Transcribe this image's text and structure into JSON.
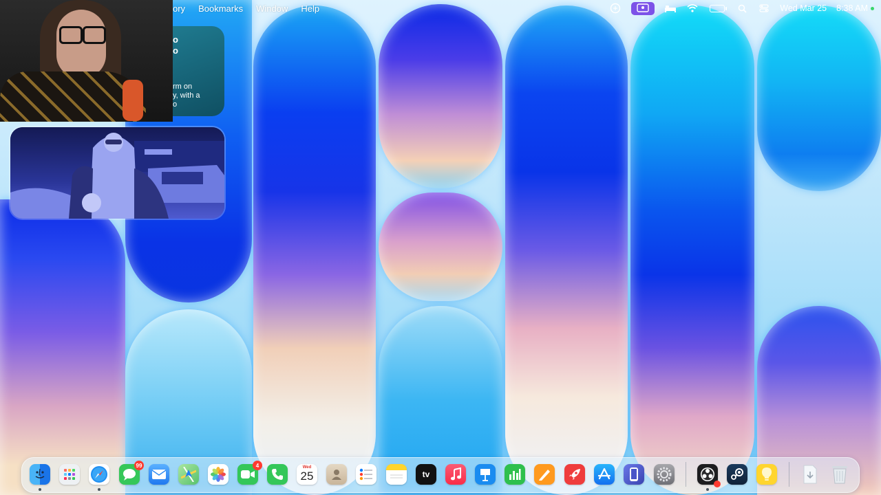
{
  "menubar": {
    "menus": [
      "ory",
      "Bookmarks",
      "Window",
      "Help"
    ],
    "clock": {
      "date": "Wed Mar 25",
      "time": "8:38 AM"
    },
    "icons": [
      "screen-share-icon",
      "user-switch-icon",
      "bed-sleep-icon",
      "wifi-icon",
      "battery-icon",
      "spotlight-search-icon",
      "control-center-icon"
    ]
  },
  "widgets": {
    "note": {
      "title_lines": [
        "o",
        "o"
      ],
      "body_lines": [
        "rm on",
        "y, with a",
        "o"
      ]
    }
  },
  "dock": {
    "apps": [
      {
        "name": "Finder",
        "icon": "finder-icon",
        "color": "#1e8ff0",
        "running": true
      },
      {
        "name": "Launchpad",
        "icon": "launchpad-icon",
        "color": "#e9ecef"
      },
      {
        "name": "Safari",
        "icon": "safari-icon",
        "color": "#1a7ef2",
        "running": true
      },
      {
        "name": "Messages",
        "icon": "messages-icon",
        "color": "#35c759",
        "badge": "99"
      },
      {
        "name": "Mail",
        "icon": "mail-icon",
        "color": "#2f8cf2"
      },
      {
        "name": "Maps",
        "icon": "maps-icon",
        "color": "#58c16c"
      },
      {
        "name": "Photos",
        "icon": "photos-icon",
        "color": "#ffffff"
      },
      {
        "name": "FaceTime",
        "icon": "facetime-icon",
        "color": "#34c759",
        "badge": "4"
      },
      {
        "name": "Phone",
        "icon": "phone-icon",
        "color": "#34c759"
      },
      {
        "name": "Calendar",
        "icon": "calendar-icon",
        "color": "#ffffff",
        "month": "Wed",
        "day": "25"
      },
      {
        "name": "Contacts",
        "icon": "contacts-icon",
        "color": "#c9b59a"
      },
      {
        "name": "Reminders",
        "icon": "reminders-icon",
        "color": "#ffffff"
      },
      {
        "name": "Notes",
        "icon": "notes-icon",
        "color": "#ffd52e"
      },
      {
        "name": "TV",
        "icon": "apple-tv-icon",
        "color": "#111111",
        "label": "tv"
      },
      {
        "name": "Music",
        "icon": "music-icon",
        "color": "#fa2d48"
      },
      {
        "name": "Keynote",
        "icon": "keynote-icon",
        "color": "#1a8cf0"
      },
      {
        "name": "Numbers",
        "icon": "numbers-icon",
        "color": "#2fc04d"
      },
      {
        "name": "Pages",
        "icon": "pages-icon",
        "color": "#ff9a1f"
      },
      {
        "name": "Rocket",
        "icon": "rocket-icon",
        "color": "#ef3d3d"
      },
      {
        "name": "App Store",
        "icon": "app-store-icon",
        "color": "#1f8ff2"
      },
      {
        "name": "iPhone Mirroring",
        "icon": "iphone-mirroring-icon",
        "color": "#4a55c8"
      },
      {
        "name": "System Settings",
        "icon": "system-settings-icon",
        "color": "#8e8e93"
      },
      {
        "name": "OBS",
        "icon": "obs-icon",
        "color": "#1d1d1f",
        "running": true
      },
      {
        "name": "Steam",
        "icon": "steam-icon",
        "color": "#17324f"
      },
      {
        "name": "Tips",
        "icon": "tips-lightbulb-icon",
        "color": "#ffd52e"
      },
      {
        "name": "Downloads",
        "icon": "downloads-stack-icon",
        "color": "#e6eef5"
      },
      {
        "name": "Trash",
        "icon": "trash-icon",
        "color": "#cfd6dc"
      }
    ]
  }
}
